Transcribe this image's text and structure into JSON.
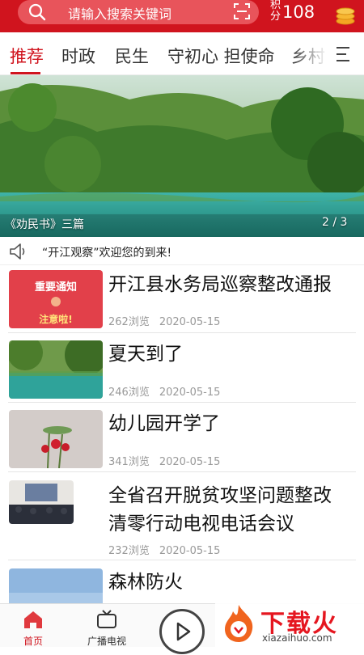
{
  "header": {
    "search_placeholder": "请输入搜索关键词",
    "points_label": "积分",
    "points_value": "108",
    "search_icon": "search-icon",
    "scan_icon": "scan-icon",
    "coin_icon": "coins-icon",
    "accent_color": "#d0141e"
  },
  "tabs": [
    {
      "label": "推荐",
      "active": true
    },
    {
      "label": "时政",
      "active": false
    },
    {
      "label": "民生",
      "active": false
    },
    {
      "label": "守初心 担使命",
      "active": false
    },
    {
      "label": "乡村",
      "active": false
    }
  ],
  "banner": {
    "caption": "《劝民书》三篇",
    "page_indicator": "2 / 3"
  },
  "notice": {
    "icon": "speaker-icon",
    "text": "“开江观察”欢迎您的到来!"
  },
  "news": [
    {
      "title_lines": [
        "开江县水务局巡察整改通报"
      ],
      "views": "262浏览",
      "date": "2020-05-15",
      "thumb_line1": "重要通知",
      "thumb_line2": "注意啦!"
    },
    {
      "title_lines": [
        "夏天到了"
      ],
      "views": "246浏览",
      "date": "2020-05-15"
    },
    {
      "title_lines": [
        "幼儿园开学了"
      ],
      "views": "341浏览",
      "date": "2020-05-15"
    },
    {
      "title_lines": [
        "全省召开脱贫攻坚问题整改",
        "清零行动电视电话会议"
      ],
      "views": "232浏览",
      "date": "2020-05-15"
    },
    {
      "title_lines": [
        "森林防火"
      ],
      "views": "",
      "date": ""
    }
  ],
  "bottom_nav": [
    {
      "label": "首页",
      "icon": "home-icon",
      "active": true
    },
    {
      "label": "广播电视",
      "icon": "tv-icon",
      "active": false
    },
    {
      "label": "",
      "icon": "play-icon",
      "active": false
    }
  ],
  "watermark": {
    "text": "下载火",
    "url": "xiazaihuo.com"
  }
}
